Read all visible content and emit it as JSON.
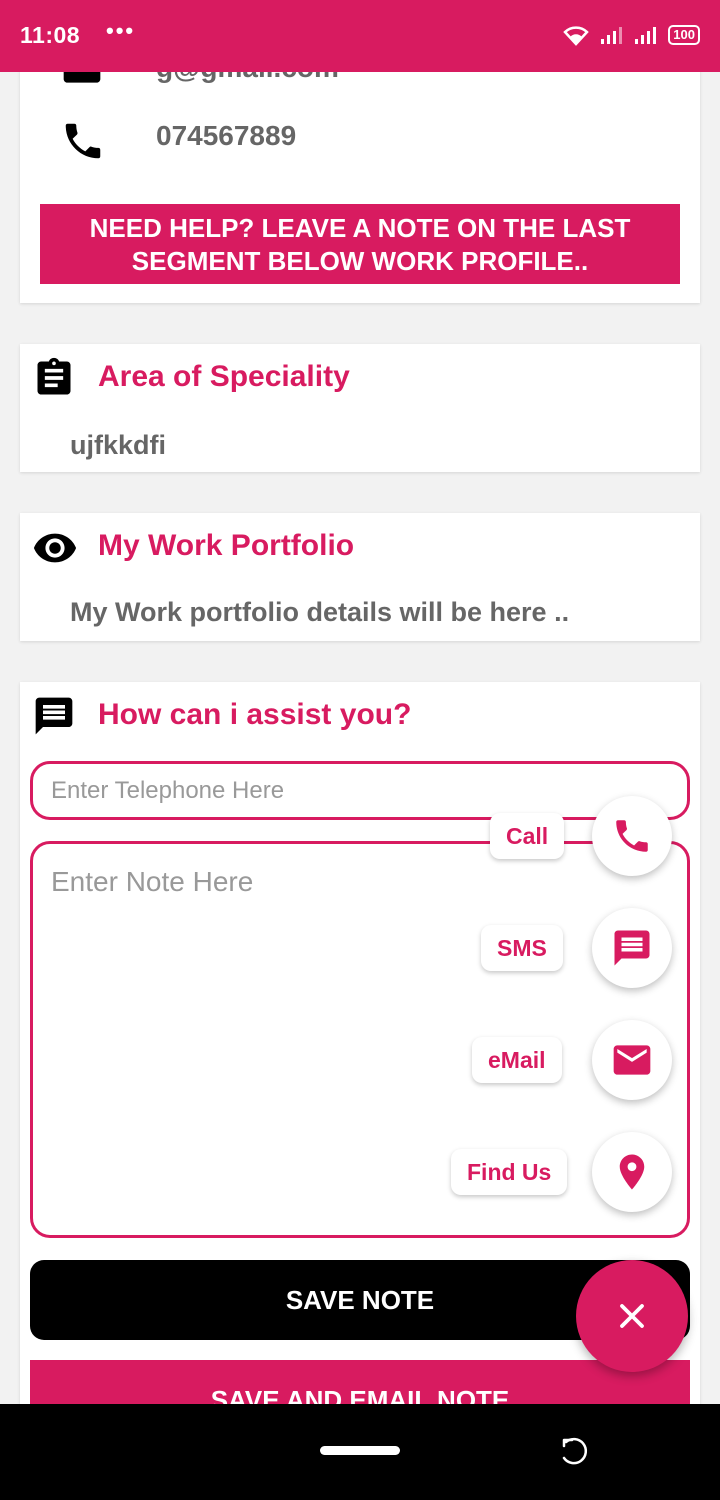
{
  "status_bar": {
    "time": "11:08",
    "dots": "•••",
    "battery": "100"
  },
  "contact": {
    "email": "g@gmail.com",
    "phone": "074567889",
    "help_banner": "NEED HELP? LEAVE A NOTE ON THE LAST SEGMENT BELOW WORK PROFILE.."
  },
  "speciality": {
    "title": "Area of Speciality",
    "value": "ujfkkdfi"
  },
  "portfolio": {
    "title": "My Work Portfolio",
    "value": "My Work portfolio details will be here .."
  },
  "assist": {
    "title": "How can i assist you?",
    "telephone_placeholder": "Enter Telephone Here",
    "note_placeholder": "Enter Note Here",
    "save_note": "SAVE NOTE",
    "save_email_note": "SAVE AND EMAIL NOTE"
  },
  "fab": {
    "call": "Call",
    "sms": "SMS",
    "email": "eMail",
    "find_us": "Find Us"
  },
  "colors": {
    "accent": "#d81b60",
    "background": "#f2f2f2"
  }
}
